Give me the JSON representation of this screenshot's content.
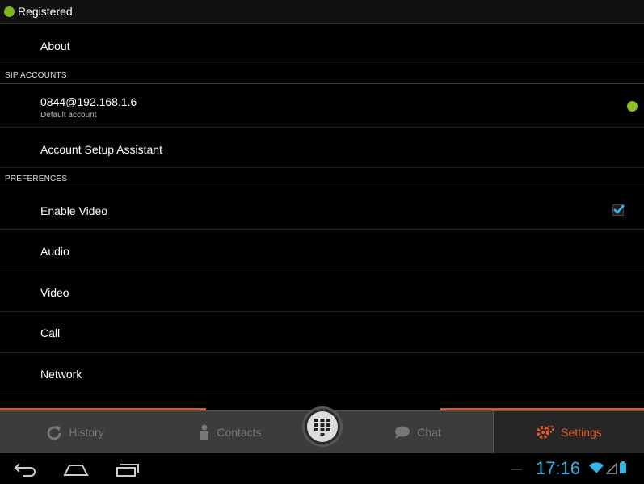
{
  "status": {
    "text": "Registered",
    "color": "#7fb41a"
  },
  "list": {
    "about": "About",
    "sip_header": "SIP ACCOUNTS",
    "account": {
      "title": "0844@192.168.1.6",
      "subtitle": "Default account",
      "status_color": "#8cbf1f"
    },
    "setup_assistant": "Account Setup Assistant",
    "pref_header": "PREFERENCES",
    "enable_video": {
      "label": "Enable Video",
      "checked": true
    },
    "audio": "Audio",
    "video": "Video",
    "call": "Call",
    "network": "Network"
  },
  "tabs": [
    {
      "label": "History",
      "icon": "refresh-icon"
    },
    {
      "label": "Contacts",
      "icon": "person-icon"
    },
    {
      "label": "Chat",
      "icon": "speech-bubble-icon"
    },
    {
      "label": "Settings",
      "icon": "gears-icon",
      "active": true
    }
  ],
  "accent_color": "#e05a2b",
  "system": {
    "time": "17:16"
  }
}
